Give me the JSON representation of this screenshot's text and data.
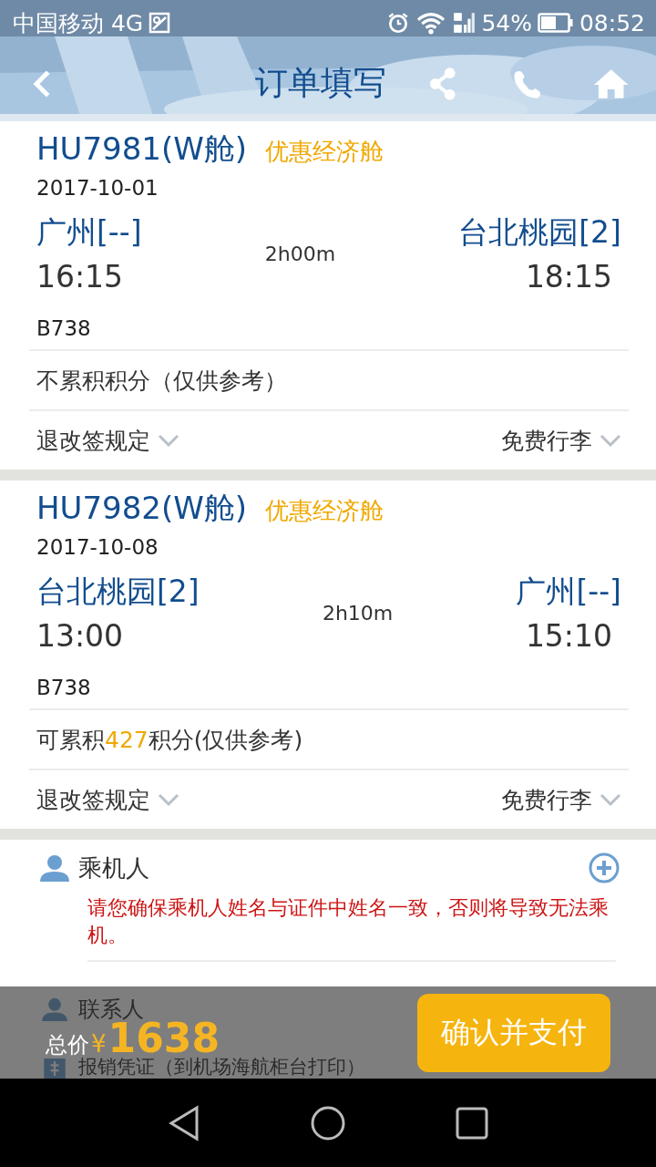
{
  "status_bar": {
    "carrier": "中国移动 4G",
    "battery": "54%",
    "time": "08:52"
  },
  "header": {
    "title": "订单填写"
  },
  "flights": [
    {
      "flight_no": "HU7981(W舱)",
      "cabin": "优惠经济舱",
      "date": "2017-10-01",
      "departure": {
        "airport": "广州[--]",
        "time": "16:15"
      },
      "duration": "2h00m",
      "arrival": {
        "airport": "台北桃园[2]",
        "time": "18:15"
      },
      "aircraft": "B738",
      "points": [
        {
          "text": "不累积积分（仅供参考）",
          "highlight": false
        }
      ],
      "rules": "退改签规定",
      "baggage": "免费行李"
    },
    {
      "flight_no": "HU7982(W舱)",
      "cabin": "优惠经济舱",
      "date": "2017-10-08",
      "departure": {
        "airport": "台北桃园[2]",
        "time": "13:00"
      },
      "duration": "2h10m",
      "arrival": {
        "airport": "广州[--]",
        "time": "15:10"
      },
      "aircraft": "B738",
      "points": [
        {
          "text": "可累积",
          "highlight": false
        },
        {
          "text": "427",
          "highlight": true
        },
        {
          "text": "积分(仅供参考)",
          "highlight": false
        }
      ],
      "rules": "退改签规定",
      "baggage": "免费行李"
    }
  ],
  "passenger": {
    "title": "乘机人",
    "warning": "请您确保乘机人姓名与证件中姓名一致，否则将导致无法乘机。"
  },
  "contact": {
    "title": "联系人"
  },
  "invoice": {
    "title": "报销凭证（到机场海航柜台打印）"
  },
  "total": {
    "label": "总价",
    "currency": "¥",
    "amount": "1638"
  },
  "pay_button": "确认并支付"
}
